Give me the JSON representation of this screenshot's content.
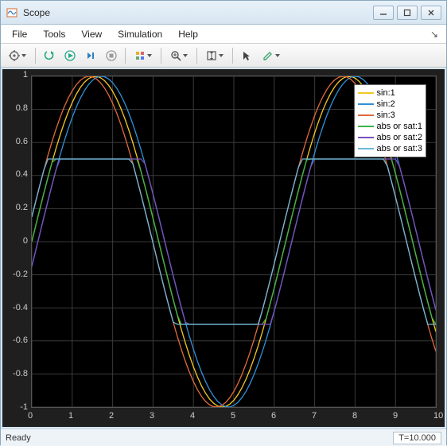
{
  "window": {
    "title": "Scope"
  },
  "menu": {
    "items": [
      "File",
      "Tools",
      "View",
      "Simulation",
      "Help"
    ]
  },
  "toolbar": {
    "icons": [
      "settings-gear",
      "restart",
      "run",
      "step",
      "stop",
      "highlight",
      "zoom",
      "autoscale",
      "cursor",
      "annotate"
    ]
  },
  "chart_data": {
    "type": "line",
    "xlabel": "",
    "ylabel": "",
    "xlim": [
      0,
      10
    ],
    "ylim": [
      -1,
      1
    ],
    "xticks": [
      0,
      1,
      2,
      3,
      4,
      5,
      6,
      7,
      8,
      9,
      10
    ],
    "yticks": [
      -1,
      -0.8,
      -0.6,
      -0.4,
      -0.2,
      0,
      0.2,
      0.4,
      0.6,
      0.8,
      1
    ],
    "x": [
      0.0,
      0.1,
      0.2,
      0.3,
      0.4,
      0.5,
      0.6,
      0.7,
      0.8,
      0.9,
      1.0,
      1.1,
      1.2,
      1.3,
      1.4,
      1.5,
      1.6,
      1.7,
      1.8,
      1.9,
      2.0,
      2.1,
      2.2,
      2.3,
      2.4,
      2.5,
      2.6,
      2.7,
      2.8,
      2.9,
      3.0,
      3.1,
      3.2,
      3.3,
      3.4,
      3.5,
      3.6,
      3.7,
      3.8,
      3.9,
      4.0,
      4.1,
      4.2,
      4.3,
      4.4,
      4.5,
      4.6,
      4.7,
      4.8,
      4.9,
      5.0,
      5.1,
      5.2,
      5.3,
      5.4,
      5.5,
      5.6,
      5.7,
      5.8,
      5.9,
      6.0,
      6.1,
      6.2,
      6.3,
      6.4,
      6.5,
      6.6,
      6.7,
      6.8,
      6.9,
      7.0,
      7.1,
      7.2,
      7.3,
      7.4,
      7.5,
      7.6,
      7.7,
      7.8,
      7.9,
      8.0,
      8.1,
      8.2,
      8.3,
      8.4,
      8.5,
      8.6,
      8.7,
      8.8,
      8.9,
      9.0,
      9.1,
      9.2,
      9.3,
      9.4,
      9.5,
      9.6,
      9.7,
      9.8,
      9.9,
      10.0
    ],
    "series": [
      {
        "name": "sin:1",
        "color": "#f2c724",
        "phase": 0.0,
        "type": "sin"
      },
      {
        "name": "sin:2",
        "color": "#2f8fd8",
        "phase": -0.15,
        "type": "sin"
      },
      {
        "name": "sin:3",
        "color": "#e06a3a",
        "phase": 0.15,
        "type": "sin"
      },
      {
        "name": "abs or sat:1",
        "color": "#3bb24a",
        "phase": 0.0,
        "type": "sat"
      },
      {
        "name": "abs or sat:2",
        "color": "#7a4fbf",
        "phase": -0.15,
        "type": "sat"
      },
      {
        "name": "abs or sat:3",
        "color": "#6fb7d6",
        "phase": 0.15,
        "type": "sat"
      }
    ]
  },
  "legend": {
    "items": [
      {
        "label": "sin:1",
        "color": "#f2c724"
      },
      {
        "label": "sin:2",
        "color": "#2f8fd8"
      },
      {
        "label": "sin:3",
        "color": "#e06a3a"
      },
      {
        "label": "abs or sat:1",
        "color": "#3bb24a"
      },
      {
        "label": "abs or sat:2",
        "color": "#7a4fbf"
      },
      {
        "label": "abs or sat:3",
        "color": "#6fb7d6"
      }
    ]
  },
  "status": {
    "text": "Ready",
    "time": "T=10.000"
  }
}
